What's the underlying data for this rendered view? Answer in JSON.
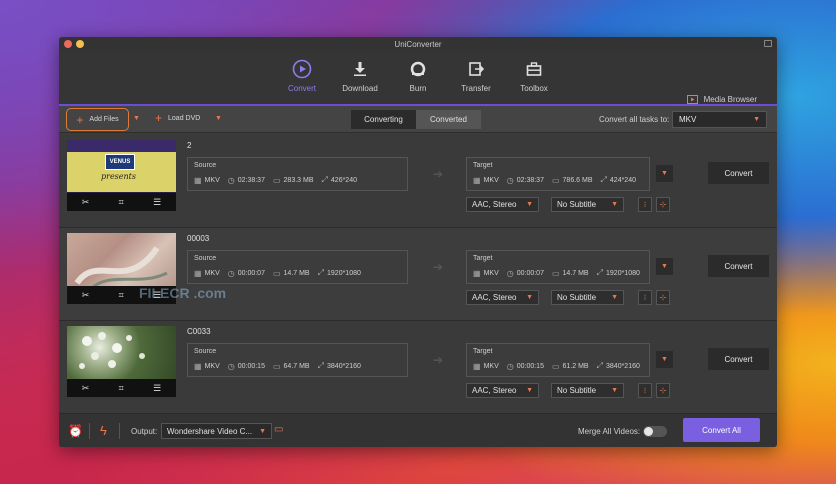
{
  "window": {
    "title": "UniConverter"
  },
  "nav": {
    "items": [
      {
        "label": "Convert",
        "icon": "play-circle-icon",
        "active": true
      },
      {
        "label": "Download",
        "icon": "download-icon",
        "active": false
      },
      {
        "label": "Burn",
        "icon": "disc-icon",
        "active": false
      },
      {
        "label": "Transfer",
        "icon": "transfer-icon",
        "active": false
      },
      {
        "label": "Toolbox",
        "icon": "toolbox-icon",
        "active": false
      }
    ],
    "media_browser": "Media Browser"
  },
  "toolbar": {
    "add_files": "Add Files",
    "load_dvd": "Load DVD",
    "tabs": [
      "Converting",
      "Converted"
    ],
    "convert_all_to": "Convert all tasks to:",
    "format": "MKV"
  },
  "rows": [
    {
      "name": "2",
      "source": {
        "label": "Source",
        "format": "MKV",
        "duration": "02:38:37",
        "size": "283.3 MB",
        "resolution": "426*240"
      },
      "target": {
        "label": "Target",
        "format": "MKV",
        "duration": "02:38:37",
        "size": "786.6 MB",
        "resolution": "424*240"
      },
      "audio": "AAC, Stereo",
      "subtitle": "No Subtitle",
      "convert": "Convert",
      "thumb_text": [
        "VENUS",
        "presents"
      ]
    },
    {
      "name": "00003",
      "source": {
        "label": "Source",
        "format": "MKV",
        "duration": "00:00:07",
        "size": "14.7 MB",
        "resolution": "1920*1080"
      },
      "target": {
        "label": "Target",
        "format": "MKV",
        "duration": "00:00:07",
        "size": "14.7 MB",
        "resolution": "1920*1080"
      },
      "audio": "AAC, Stereo",
      "subtitle": "No Subtitle",
      "convert": "Convert"
    },
    {
      "name": "C0033",
      "source": {
        "label": "Source",
        "format": "MKV",
        "duration": "00:00:15",
        "size": "64.7 MB",
        "resolution": "3840*2160"
      },
      "target": {
        "label": "Target",
        "format": "MKV",
        "duration": "00:00:15",
        "size": "61.2 MB",
        "resolution": "3840*2160"
      },
      "audio": "AAC, Stereo",
      "subtitle": "No Subtitle",
      "convert": "Convert"
    }
  ],
  "footer": {
    "output_label": "Output:",
    "output_value": "Wondershare Video C...",
    "merge_label": "Merge All Videos:",
    "merge_on": false,
    "convert_all": "Convert All"
  },
  "watermark": "FILECR .com",
  "colors": {
    "accent": "#7a5fe0",
    "orange": "#e8794a"
  }
}
